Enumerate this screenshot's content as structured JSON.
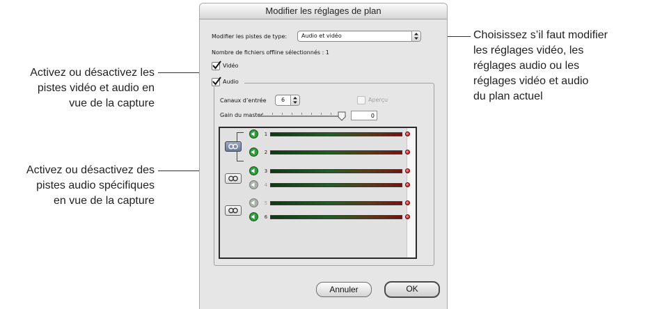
{
  "window": {
    "title": "Modifier les réglages de plan"
  },
  "form": {
    "track_type_label": "Modifier les pistes de type:",
    "track_type_value": "Audio et vidéo",
    "offline_count_label": "Nombre de fichiers offline sélectionnés : 1",
    "video_label": "Vidéo",
    "audio_label": "Audio",
    "input_channels_label": "Canaux d’entrée",
    "input_channels_value": "6",
    "preview_label": "Aperçu",
    "master_gain_label": "Gain du master",
    "master_gain_value": "0"
  },
  "tracks": [
    {
      "number": "1",
      "enabled": true
    },
    {
      "number": "2",
      "enabled": true
    },
    {
      "number": "3",
      "enabled": true
    },
    {
      "number": "4",
      "enabled": false
    },
    {
      "number": "5",
      "enabled": false
    },
    {
      "number": "6",
      "enabled": true
    }
  ],
  "buttons": {
    "cancel": "Annuler",
    "ok": "OK"
  },
  "callouts": {
    "left_top": [
      "Activez ou désactivez les",
      "pistes vidéo et audio en",
      "vue de la capture"
    ],
    "left_bottom": [
      "Activez ou désactivez des",
      "pistes audio spécifiques",
      "en vue de la capture"
    ],
    "right": [
      "Choisissez s’il faut modifier",
      "les réglages vidéo, les",
      "réglages audio ou les",
      "réglages vidéo et audio",
      "du plan actuel"
    ]
  },
  "colors": {
    "meter_green": "#1f5e22",
    "meter_red": "#7a1010",
    "peak_red": "#b40000",
    "speaker_green": "#2e9e3a"
  }
}
